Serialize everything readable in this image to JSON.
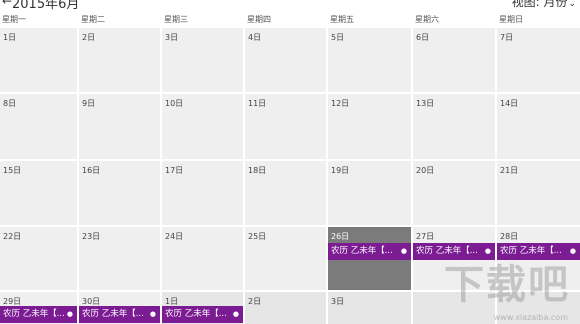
{
  "header": {
    "month_title": "2015年6月",
    "view_label": "视图: 月份"
  },
  "weekdays": [
    "星期一",
    "星期二",
    "星期三",
    "星期四",
    "星期五",
    "星期六",
    "星期日"
  ],
  "rows": [
    [
      "1日",
      "2日",
      "3日",
      "4日",
      "5日",
      "6日",
      "7日"
    ],
    [
      "8日",
      "9日",
      "10日",
      "11日",
      "12日",
      "13日",
      "14日"
    ],
    [
      "15日",
      "16日",
      "17日",
      "18日",
      "19日",
      "20日",
      "21日"
    ],
    [
      "22日",
      "23日",
      "24日",
      "25日",
      "26日",
      "27日",
      "28日"
    ],
    [
      "29日",
      "30日",
      "1日",
      "2日",
      "3日",
      "",
      ""
    ]
  ],
  "event_label": "农历 乙未年【...",
  "colors": {
    "event": "#7b1c93",
    "today": "#7b7b7b",
    "cell": "#efefef"
  },
  "watermark": {
    "brand": "下载吧",
    "url": "www.xiazaiba.com"
  }
}
